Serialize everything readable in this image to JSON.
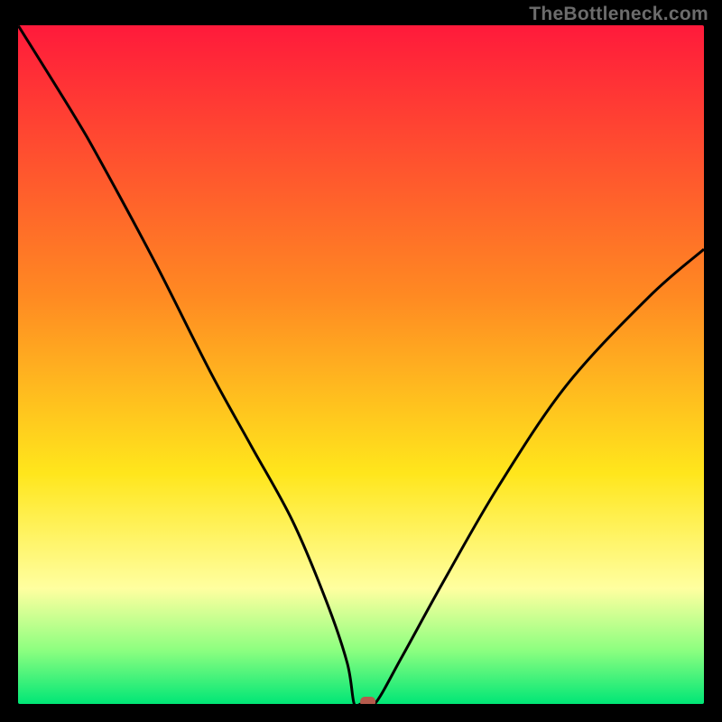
{
  "watermark": "TheBottleneck.com",
  "colors": {
    "red": "#ff1a3b",
    "orange": "#ff8a22",
    "yellow": "#ffe61c",
    "yellow_pale": "#ffffa0",
    "light_green": "#8eff80",
    "green": "#00e676",
    "curve": "#000000",
    "marker": "#b55a4c"
  },
  "chart_data": {
    "type": "line",
    "title": "",
    "xlabel": "",
    "ylabel": "",
    "ylim": [
      0,
      100
    ],
    "xlim": [
      0,
      100
    ],
    "series": [
      {
        "name": "curve",
        "x": [
          0,
          8,
          12,
          20,
          28,
          34,
          40,
          45,
          48,
          49,
          50,
          52,
          56,
          62,
          70,
          80,
          92,
          100
        ],
        "values": [
          100,
          87,
          80,
          65,
          49,
          38,
          27,
          15,
          6,
          0,
          0,
          0,
          7,
          18,
          32,
          47,
          60,
          67
        ]
      }
    ],
    "marker": {
      "x": 51,
      "y": 0
    },
    "gradient_stops": [
      {
        "offset": 0,
        "color_key": "red"
      },
      {
        "offset": 0.4,
        "color_key": "orange"
      },
      {
        "offset": 0.66,
        "color_key": "yellow"
      },
      {
        "offset": 0.83,
        "color_key": "yellow_pale"
      },
      {
        "offset": 0.92,
        "color_key": "light_green"
      },
      {
        "offset": 1.0,
        "color_key": "green"
      }
    ]
  }
}
